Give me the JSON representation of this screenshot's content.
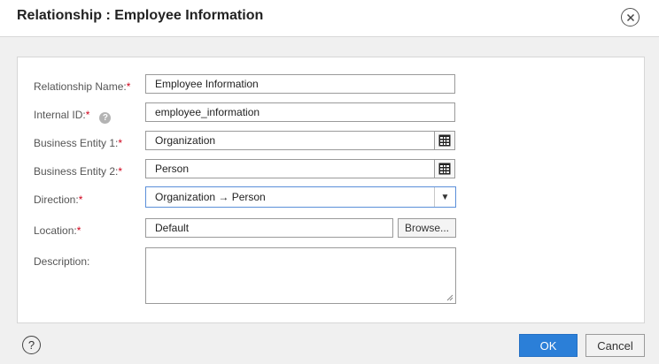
{
  "dialog": {
    "title": "Relationship : Employee Information",
    "close_icon": "close-icon"
  },
  "form": {
    "relationship_name": {
      "label": "Relationship Name:",
      "required": "*",
      "value": "Employee Information"
    },
    "internal_id": {
      "label": "Internal ID:",
      "required": "*",
      "help_glyph": "?",
      "value": "employee_information"
    },
    "business_entity_1": {
      "label": "Business Entity 1:",
      "required": "*",
      "value": "Organization",
      "lookup_icon": "lookup-grid-icon"
    },
    "business_entity_2": {
      "label": "Business Entity 2:",
      "required": "*",
      "value": "Person",
      "lookup_icon": "lookup-grid-icon"
    },
    "direction": {
      "label": "Direction:",
      "required": "*",
      "value": "Organization → Person",
      "arrow_glyph": "▼"
    },
    "location": {
      "label": "Location:",
      "required": "*",
      "value": "Default",
      "browse_label": "Browse..."
    },
    "description": {
      "label": "Description:",
      "value": ""
    }
  },
  "footer": {
    "help_glyph": "?",
    "ok_label": "OK",
    "cancel_label": "Cancel"
  },
  "colors": {
    "primary_button": "#2b7fd8",
    "required_marker": "#d0021b",
    "focus_border": "#5b8fd9"
  }
}
